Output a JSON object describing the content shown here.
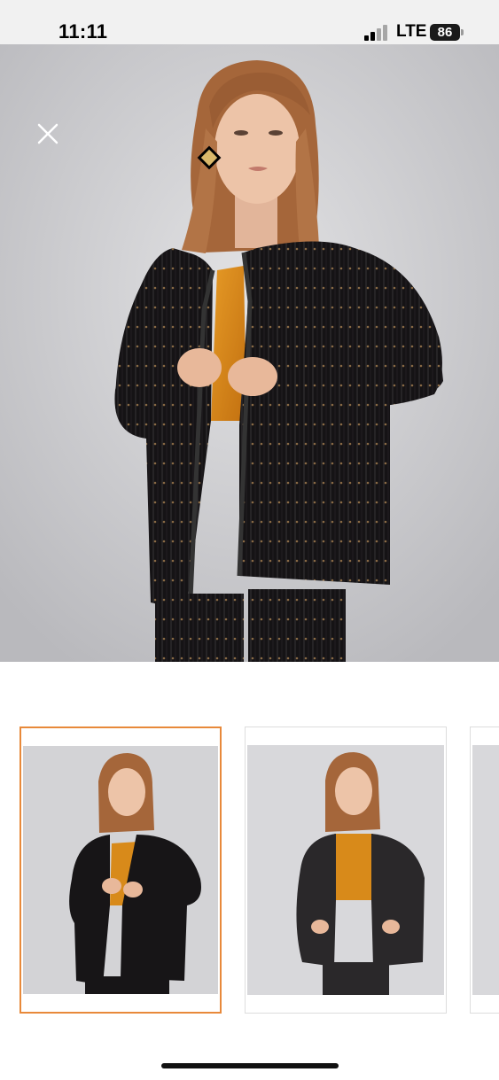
{
  "status_bar": {
    "time": "11:11",
    "network": "LTE",
    "battery": "86"
  },
  "hero": {
    "image": "model-in-black-velvet-embroidered-jacket-and-orange-top",
    "close_icon": "close-icon"
  },
  "thumbnails": [
    {
      "selected": true,
      "image": "model-hands-on-lapels"
    },
    {
      "selected": false,
      "image": "model-hands-in-pockets"
    },
    {
      "selected": false,
      "image": "partial-thumbnail"
    }
  ],
  "colors": {
    "selected_border": "#e8893a",
    "background": "#d4d4d6",
    "jacket": "#141214",
    "top": "#d88a1a",
    "hair": "#a8693a"
  }
}
